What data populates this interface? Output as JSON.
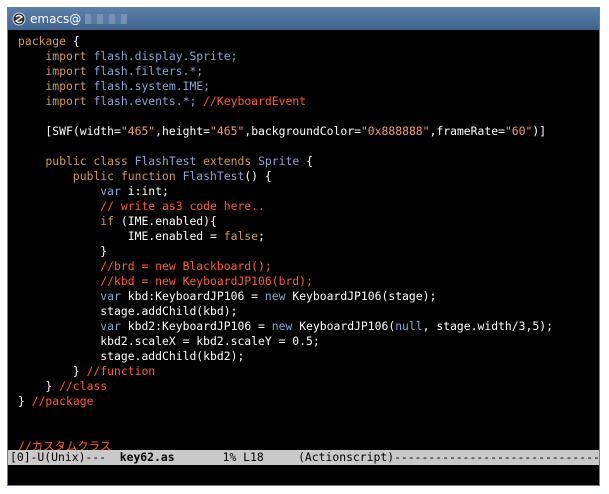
{
  "window": {
    "title": "emacs@"
  },
  "editor": {
    "lines": [
      [
        [
          "package",
          "kw"
        ],
        [
          " {",
          "bk"
        ]
      ],
      [
        [
          "    import ",
          "kw"
        ],
        [
          "flash.display.Sprite;",
          "ty"
        ]
      ],
      [
        [
          "    import ",
          "kw"
        ],
        [
          "flash.filters.*;",
          "ty"
        ]
      ],
      [
        [
          "    import ",
          "kw"
        ],
        [
          "flash.system.IME;",
          "ty"
        ]
      ],
      [
        [
          "    import ",
          "kw"
        ],
        [
          "flash.events.*;",
          "ty"
        ],
        [
          " //KeyboardEvent",
          "cm"
        ]
      ],
      [],
      [
        [
          "    [SWF(width=",
          "id"
        ],
        [
          "\"465\"",
          "str"
        ],
        [
          ",height=",
          "id"
        ],
        [
          "\"465\"",
          "str"
        ],
        [
          ",backgroundColor=",
          "id"
        ],
        [
          "\"0x888888\"",
          "str"
        ],
        [
          ",frameRate=",
          "id"
        ],
        [
          "\"60\"",
          "str"
        ],
        [
          ")]",
          "id"
        ]
      ],
      [],
      [
        [
          "    public class ",
          "kw"
        ],
        [
          "FlashTest",
          "ty"
        ],
        [
          " extends ",
          "kw"
        ],
        [
          "Sprite",
          "ty"
        ],
        [
          " {",
          "bk"
        ]
      ],
      [
        [
          "        public function ",
          "kw"
        ],
        [
          "FlashTest",
          "ty"
        ],
        [
          "() {",
          "bk"
        ]
      ],
      [
        [
          "            var ",
          "ty"
        ],
        [
          "i:int",
          "id"
        ],
        [
          ";",
          "bk"
        ]
      ],
      [
        [
          "            // write as3 code here..",
          "cm"
        ]
      ],
      [
        [
          "            if",
          "kw"
        ],
        [
          " (IME.enabled){",
          "id"
        ]
      ],
      [
        [
          "                IME.enabled = ",
          "id"
        ],
        [
          "false",
          "kw"
        ],
        [
          ";",
          "id"
        ]
      ],
      [
        [
          "            }",
          "bk"
        ]
      ],
      [
        [
          "            //brd = new Blackboard();",
          "cm"
        ]
      ],
      [
        [
          "            //kbd = new KeyboardJP106(brd);",
          "cm"
        ]
      ],
      [
        [
          "            var ",
          "ty"
        ],
        [
          "kbd:KeyboardJP106 = ",
          "id"
        ],
        [
          "new ",
          "ty"
        ],
        [
          "KeyboardJP106(stage);",
          "id"
        ]
      ],
      [
        [
          "            stage.addChild(kbd);",
          "id"
        ]
      ],
      [
        [
          "            var ",
          "ty"
        ],
        [
          "kbd2:KeyboardJP106 = ",
          "id"
        ],
        [
          "new ",
          "ty"
        ],
        [
          "KeyboardJP106(",
          "id"
        ],
        [
          "null",
          "ty"
        ],
        [
          ", stage.width/3,5);",
          "id"
        ]
      ],
      [
        [
          "            kbd2.scaleX = kbd2.scaleY = 0.5;",
          "id"
        ]
      ],
      [
        [
          "            stage.addChild(kbd2);",
          "id"
        ]
      ],
      [
        [
          "        } ",
          "bk"
        ],
        [
          "//function",
          "cm"
        ]
      ],
      [
        [
          "    } ",
          "bk"
        ],
        [
          "//class",
          "cm"
        ]
      ],
      [
        [
          "} ",
          "bk"
        ],
        [
          "//package",
          "cm"
        ]
      ],
      [],
      [],
      [
        [
          "//カスタムクラス",
          "cm"
        ]
      ]
    ]
  },
  "modeline": {
    "prefix": "[0]-U(Unix)---  ",
    "buffer": "key62.as",
    "position": "       1% L18     ",
    "mode": "(Actionscript)",
    "fill": "------------------------------------------------"
  }
}
